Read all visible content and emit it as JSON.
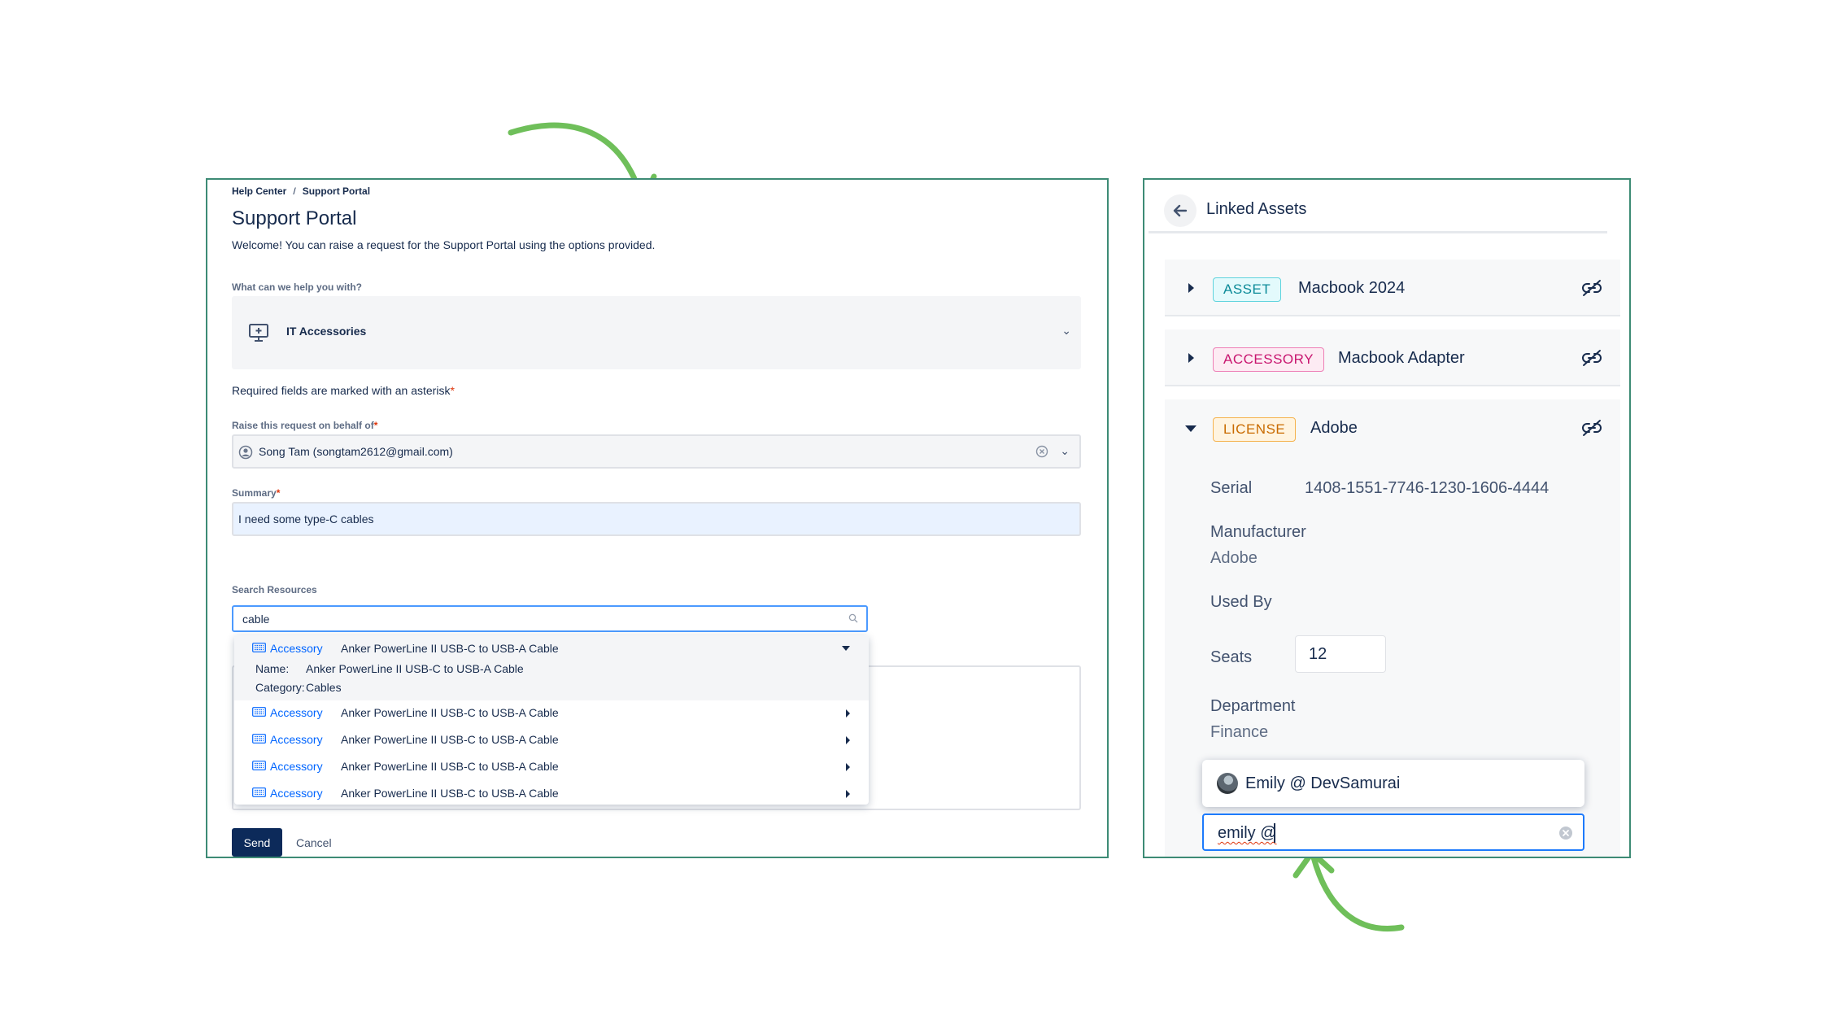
{
  "breadcrumb": [
    "Help Center",
    "/",
    "Support Portal"
  ],
  "portal": {
    "title": "Support Portal",
    "welcome": "Welcome! You can raise a request for the Support Portal using the options provided."
  },
  "request_type": {
    "label": "What can we help you with?",
    "value": "IT Accessories",
    "icon": "monitor-icon"
  },
  "required_note": "Required fields are marked with an asterisk",
  "behalf": {
    "label": "Raise this request on behalf of",
    "value": "Song Tam (songtam2612@gmail.com)"
  },
  "summary": {
    "label": "Summary",
    "value": "I need some type-C cables"
  },
  "search": {
    "label": "Search Resources",
    "value": "cable"
  },
  "results": [
    {
      "type": "Accessory",
      "name": "Anker PowerLine II USB-C to USB-A Cable",
      "expanded": true,
      "details": [
        {
          "key": "Name:",
          "value": "Anker PowerLine II USB-C to USB-A Cable"
        },
        {
          "key": "Category:",
          "value": "Cables"
        }
      ]
    },
    {
      "type": "Accessory",
      "name": "Anker PowerLine II USB-C to USB-A Cable",
      "expanded": false
    },
    {
      "type": "Accessory",
      "name": "Anker PowerLine II USB-C to USB-A Cable",
      "expanded": false
    },
    {
      "type": "Accessory",
      "name": "Anker PowerLine II USB-C to USB-A Cable",
      "expanded": false
    },
    {
      "type": "Accessory",
      "name": "Anker PowerLine II USB-C to USB-A Cable",
      "expanded": false
    }
  ],
  "buttons": {
    "send": "Send",
    "cancel": "Cancel"
  },
  "linked_assets": {
    "title": "Linked Assets",
    "items": [
      {
        "badge": "ASSET",
        "name": "Macbook 2024",
        "color": "#0b8a98"
      },
      {
        "badge": "ACCESSORY",
        "name": "Macbook Adapter",
        "color": "#c8156f"
      },
      {
        "badge": "LICENSE",
        "name": "Adobe",
        "color": "#c96b00"
      }
    ],
    "license_fields": {
      "serial_label": "Serial",
      "serial_value": "1408-1551-7746-1230-1606-4444",
      "manufacturer_label": "Manufacturer",
      "manufacturer_value": "Adobe",
      "used_by_label": "Used By",
      "seats_label": "Seats",
      "seats_value": "12",
      "department_label": "Department",
      "department_value": "Finance"
    },
    "mention_suggestion": "Emily @ DevSamurai",
    "mention_input": "emily @"
  },
  "colors": {
    "accent_border": "#3d8b75",
    "arrow_green": "#6fbf5a",
    "send_button": "#0c2a5a",
    "link_blue": "#0065ff"
  }
}
